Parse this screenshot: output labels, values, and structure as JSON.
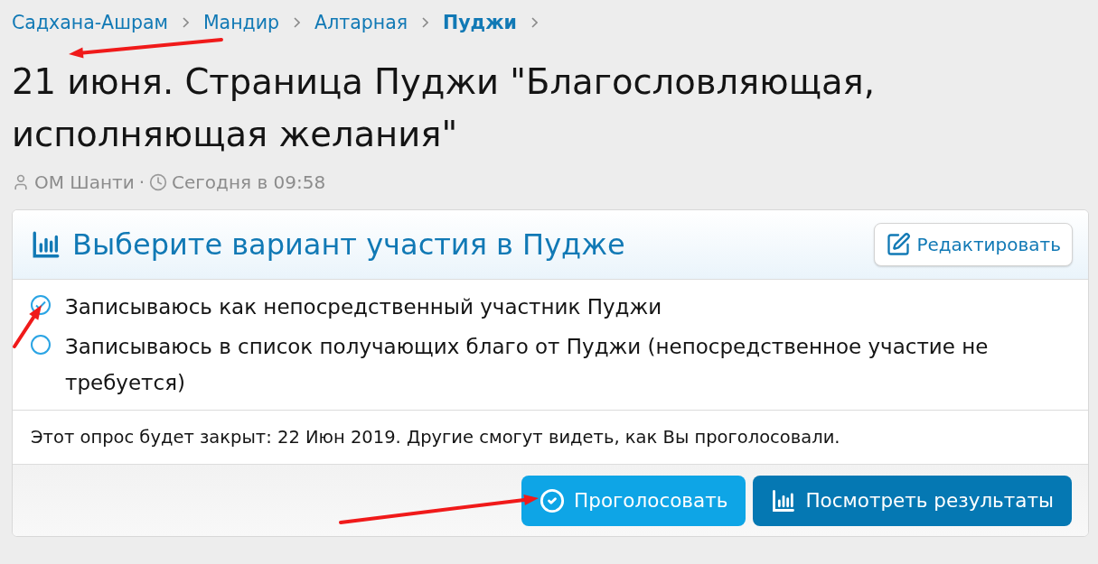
{
  "breadcrumbs": [
    {
      "label": "Садхана-Ашрам",
      "current": false
    },
    {
      "label": "Мандир",
      "current": false
    },
    {
      "label": "Алтарная",
      "current": false
    },
    {
      "label": "Пуджи",
      "current": true
    }
  ],
  "title": "21 июня. Страница Пуджи \"Благословляющая, исполняющая желания\"",
  "meta": {
    "author": "ОМ Шанти",
    "separator": "·",
    "time": "Сегодня в 09:58"
  },
  "poll": {
    "title": "Выберите вариант участия в Пудже",
    "edit_button": "Редактировать",
    "options": [
      {
        "label": "Записываюсь как непосредственный участник Пуджи",
        "selected": true
      },
      {
        "label": "Записываюсь в список получающих благо от Пуджи (непосредственное участие не требуется)",
        "selected": false
      }
    ],
    "note": "Этот опрос будет закрыт: 22 Июн 2019. Другие смогут видеть, как Вы проголосовали.",
    "buttons": [
      {
        "label": "Проголосовать",
        "kind": "primary"
      },
      {
        "label": "Посмотреть результаты",
        "kind": "secondary"
      }
    ]
  }
}
